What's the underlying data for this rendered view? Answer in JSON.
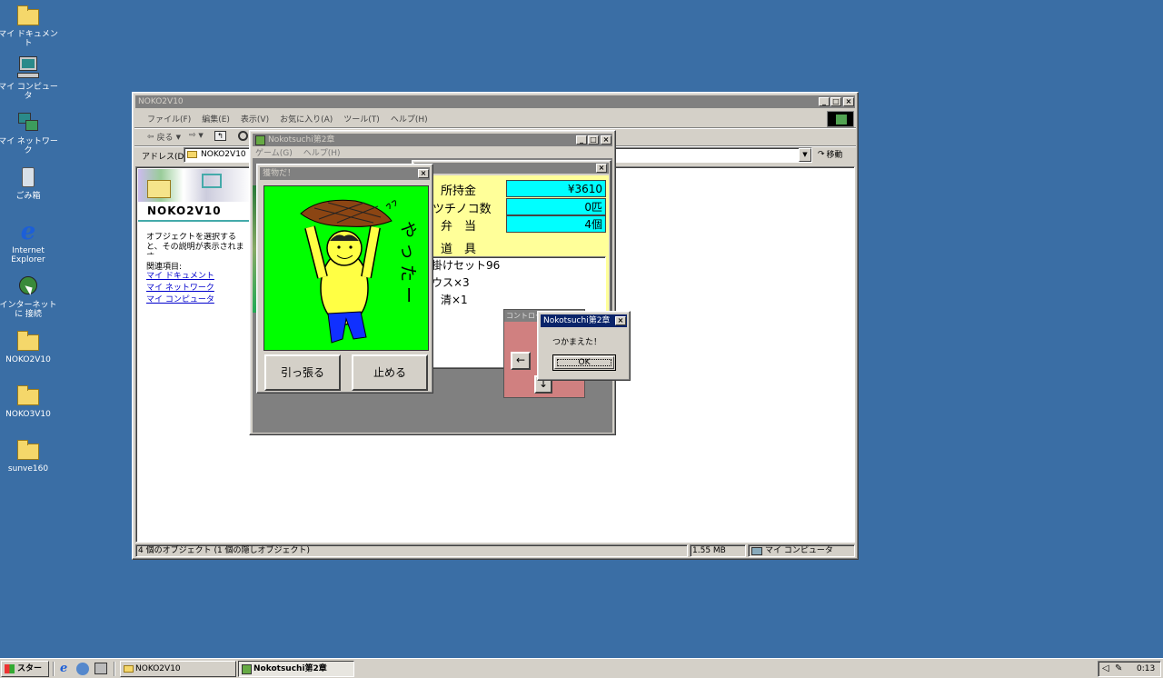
{
  "desktop": {
    "icons": [
      {
        "label": "マイ ドキュメント"
      },
      {
        "label": "マイ コンピュータ"
      },
      {
        "label": "マイ ネットワーク"
      },
      {
        "label": "ごみ箱"
      },
      {
        "label": "Internet Explorer"
      },
      {
        "label": "インターネットに 接続"
      },
      {
        "label": "NOKO2V10"
      },
      {
        "label": "NOKO3V10"
      },
      {
        "label": "sunve160"
      }
    ]
  },
  "explorer": {
    "title": "NOKO2V10",
    "menu": [
      "ファイル(F)",
      "編集(E)",
      "表示(V)",
      "お気に入り(A)",
      "ツール(T)",
      "ヘルプ(H)"
    ],
    "back": "戻る",
    "address_label": "アドレス(D)",
    "address_value": "NOKO2V10",
    "go": "移動",
    "folder_title": "NOKO2V10",
    "info_text": "オブジェクトを選択すると、その説明が表示されます。",
    "related_label": "関連項目:",
    "links": [
      "マイ ドキュメント",
      "マイ ネットワーク",
      "マイ コンピュータ"
    ],
    "status_objects": "4 個のオブジェクト (1 個の隠しオブジェクト)",
    "status_size": "1.55 MB",
    "status_location": "マイ コンピュータ"
  },
  "game": {
    "title": "Nokotsuchi第2章",
    "menu": [
      "ゲーム(G)",
      "ヘルプ(H)"
    ],
    "money_label": "所持金",
    "money_value": "¥3610",
    "noko_label": "ツチノコ数",
    "noko_value": "0匹",
    "bento_label": "弁　当",
    "bento_value": "4個",
    "tools_label": "道　具",
    "tools": [
      "掛けセット96",
      "ウス×3",
      "清×1"
    ]
  },
  "catch_dialog": {
    "title": "獲物だ！",
    "caption": "やったー",
    "pull_button": "引っ張る",
    "stop_button": "止める"
  },
  "controller": {
    "title": "コントローラ",
    "left": "←",
    "down": "↓"
  },
  "message_box": {
    "title": "Nokotsuchi第2章",
    "text": "つかまえた！",
    "ok": "OK"
  },
  "taskbar": {
    "start": "スタート",
    "tasks": [
      "NOKO2V10",
      "Nokotsuchi第2章"
    ],
    "clock": "0:13"
  }
}
